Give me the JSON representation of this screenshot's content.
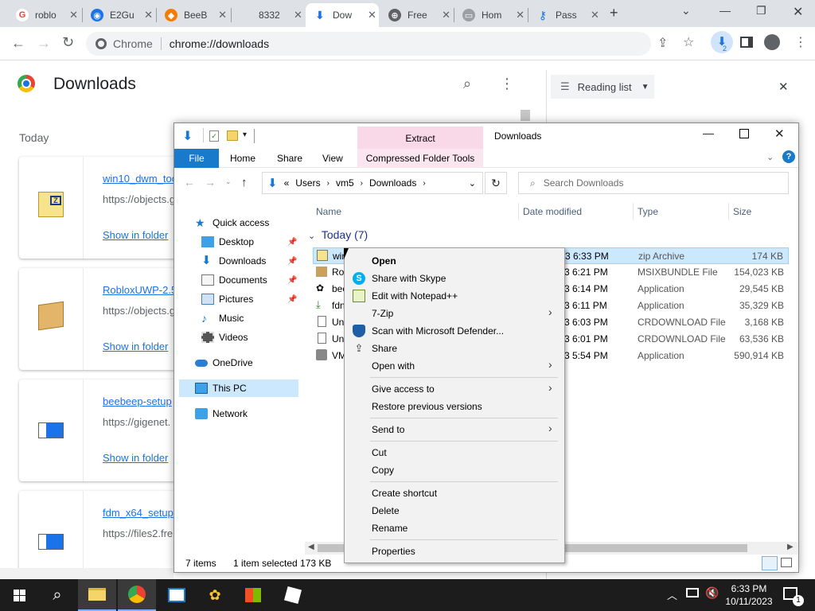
{
  "browser": {
    "tabs": [
      {
        "label": "roblo",
        "color": "#ea4335",
        "glyph": "G",
        "active": false
      },
      {
        "label": "E2Gu",
        "color": "#1a73e8",
        "glyph": "◉",
        "active": false
      },
      {
        "label": "BeeB",
        "color": "#f57c00",
        "glyph": "◆",
        "active": false
      },
      {
        "label": "8332",
        "color": "#dee1e6",
        "glyph": "",
        "active": false
      },
      {
        "label": "Dow",
        "color": "#1a73e8",
        "glyph": "↓",
        "active": true
      },
      {
        "label": "Free",
        "color": "#5f6368",
        "glyph": "⊕",
        "active": false
      },
      {
        "label": "Hom",
        "color": "#9aa0a6",
        "glyph": "▭",
        "active": false
      },
      {
        "label": "Pass",
        "color": "#1a73e8",
        "glyph": "⚷",
        "active": false
      }
    ],
    "omnibox": {
      "site": "Chrome",
      "url": "chrome://downloads"
    },
    "download_badge": "2"
  },
  "downloads_page": {
    "title": "Downloads",
    "group": "Today",
    "reading_list": "Reading list",
    "items": [
      {
        "name": "win10_dwm_toc",
        "url": "https://objects.g",
        "action": "Show in folder"
      },
      {
        "name": "RobloxUWP-2.5",
        "url": "https://objects.g",
        "action": "Show in folder"
      },
      {
        "name": "beebeep-setup",
        "url": "https://gigenet.",
        "action": "Show in folder"
      },
      {
        "name": "fdm_x64_setup",
        "url": "https://files2.fre",
        "action": "Show in folder"
      }
    ]
  },
  "explorer": {
    "title": "Downloads",
    "contextual_tab": "Extract",
    "ribbon_tabs": [
      "File",
      "Home",
      "Share",
      "View",
      "Compressed Folder Tools"
    ],
    "breadcrumb": [
      "«",
      "Users",
      "vm5",
      "Downloads"
    ],
    "search_placeholder": "Search Downloads",
    "nav": {
      "quick_access": "Quick access",
      "desktop": "Desktop",
      "downloads": "Downloads",
      "documents": "Documents",
      "pictures": "Pictures",
      "music": "Music",
      "videos": "Videos",
      "onedrive": "OneDrive",
      "this_pc": "This PC",
      "network": "Network"
    },
    "columns": {
      "name": "Name",
      "date": "Date modified",
      "type": "Type",
      "size": "Size"
    },
    "group": "Today (7)",
    "rows": [
      {
        "name": "win",
        "date": "3 6:33 PM",
        "type": "zip Archive",
        "size": "174 KB",
        "selected": true
      },
      {
        "name": "Ro",
        "date": "3 6:21 PM",
        "type": "MSIXBUNDLE File",
        "size": "154,023 KB",
        "selected": false
      },
      {
        "name": "bee",
        "date": "3 6:14 PM",
        "type": "Application",
        "size": "29,545 KB",
        "selected": false
      },
      {
        "name": "fdn",
        "date": "3 6:11 PM",
        "type": "Application",
        "size": "35,329 KB",
        "selected": false
      },
      {
        "name": "Un",
        "date": "3 6:03 PM",
        "type": "CRDOWNLOAD File",
        "size": "3,168 KB",
        "selected": false
      },
      {
        "name": "Un",
        "date": "3 6:01 PM",
        "type": "CRDOWNLOAD File",
        "size": "63,536 KB",
        "selected": false
      },
      {
        "name": "VM",
        "date": "3 5:54 PM",
        "type": "Application",
        "size": "590,914 KB",
        "selected": false
      }
    ],
    "status": {
      "count": "7 items",
      "selection": "1 item selected  173 KB"
    }
  },
  "context_menu": {
    "open": "Open",
    "skype": "Share with Skype",
    "notepad": "Edit with Notepad++",
    "zip": "7-Zip",
    "defender": "Scan with Microsoft Defender...",
    "share": "Share",
    "open_with": "Open with",
    "give_access": "Give access to",
    "restore": "Restore previous versions",
    "send_to": "Send to",
    "cut": "Cut",
    "copy": "Copy",
    "shortcut": "Create shortcut",
    "delete": "Delete",
    "rename": "Rename",
    "properties": "Properties"
  },
  "taskbar": {
    "time": "6:33 PM",
    "date": "10/11/2023",
    "notifications": "1"
  }
}
